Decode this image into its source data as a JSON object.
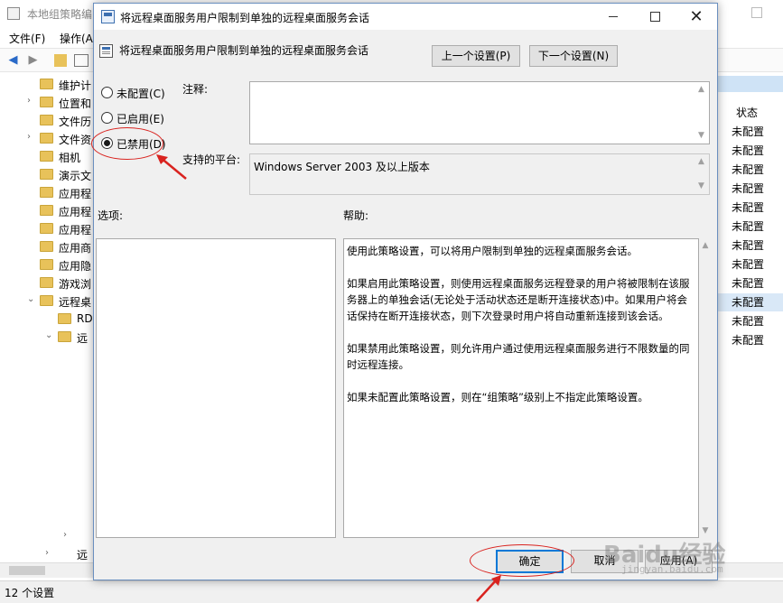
{
  "background_window": {
    "title": "本地组策略编",
    "menu": [
      "文件(F)",
      "操作(A"
    ],
    "tree_items": [
      {
        "label": "维护计",
        "chevron": ""
      },
      {
        "label": "位置和",
        "chevron": "›"
      },
      {
        "label": "文件历",
        "chevron": ""
      },
      {
        "label": "文件资",
        "chevron": "›"
      },
      {
        "label": "相机",
        "chevron": ""
      },
      {
        "label": "演示文",
        "chevron": ""
      },
      {
        "label": "应用程",
        "chevron": ""
      },
      {
        "label": "应用程",
        "chevron": ""
      },
      {
        "label": "应用程",
        "chevron": ""
      },
      {
        "label": "应用商",
        "chevron": ""
      },
      {
        "label": "应用隐",
        "chevron": ""
      },
      {
        "label": "游戏浏",
        "chevron": ""
      },
      {
        "label": "远程桌",
        "chevron": "⌄"
      },
      {
        "label": "RD",
        "chevron": ""
      },
      {
        "label": "远",
        "chevron": "⌄"
      }
    ],
    "tree_last_label": "远",
    "status_column_header": "状态",
    "status_values": [
      "未配置",
      "未配置",
      "未配置",
      "未配置",
      "未配置",
      "未配置",
      "未配置",
      "未配置",
      "未配置",
      "未配置",
      "未配置",
      "未配置"
    ],
    "statusbar_text": "12 个设置"
  },
  "dialog": {
    "title": "将远程桌面服务用户限制到单独的远程桌面服务会话",
    "policy_title": "将远程桌面服务用户限制到单独的远程桌面服务会话",
    "prev_button": "上一个设置(P)",
    "next_button": "下一个设置(N)",
    "radios": [
      {
        "label": "未配置(C)",
        "checked": false
      },
      {
        "label": "已启用(E)",
        "checked": false
      },
      {
        "label": "已禁用(D)",
        "checked": true
      }
    ],
    "comment_label": "注释:",
    "comment_value": "",
    "platform_label": "支持的平台:",
    "platform_value": "Windows Server 2003 及以上版本",
    "options_label": "选项:",
    "help_label": "帮助:",
    "help_paragraphs": [
      "使用此策略设置，可以将用户限制到单独的远程桌面服务会话。",
      "如果启用此策略设置，则使用远程桌面服务远程登录的用户将被限制在该服务器上的单独会话(无论处于活动状态还是断开连接状态)中。如果用户将会话保持在断开连接状态，则下次登录时用户将自动重新连接到该会话。",
      "如果禁用此策略设置，则允许用户通过使用远程桌面服务进行不限数量的同时远程连接。",
      "如果未配置此策略设置，则在“组策略”级别上不指定此策略设置。"
    ],
    "ok_button": "确定",
    "cancel_button": "取消",
    "apply_button": "应用(A)"
  },
  "watermark": {
    "text": "Baidu经验",
    "sub": "jingyan.baidu.com"
  },
  "colors": {
    "annotation": "#d9231f",
    "accent": "#0078d7",
    "selected_row": "#d9e8f7"
  }
}
